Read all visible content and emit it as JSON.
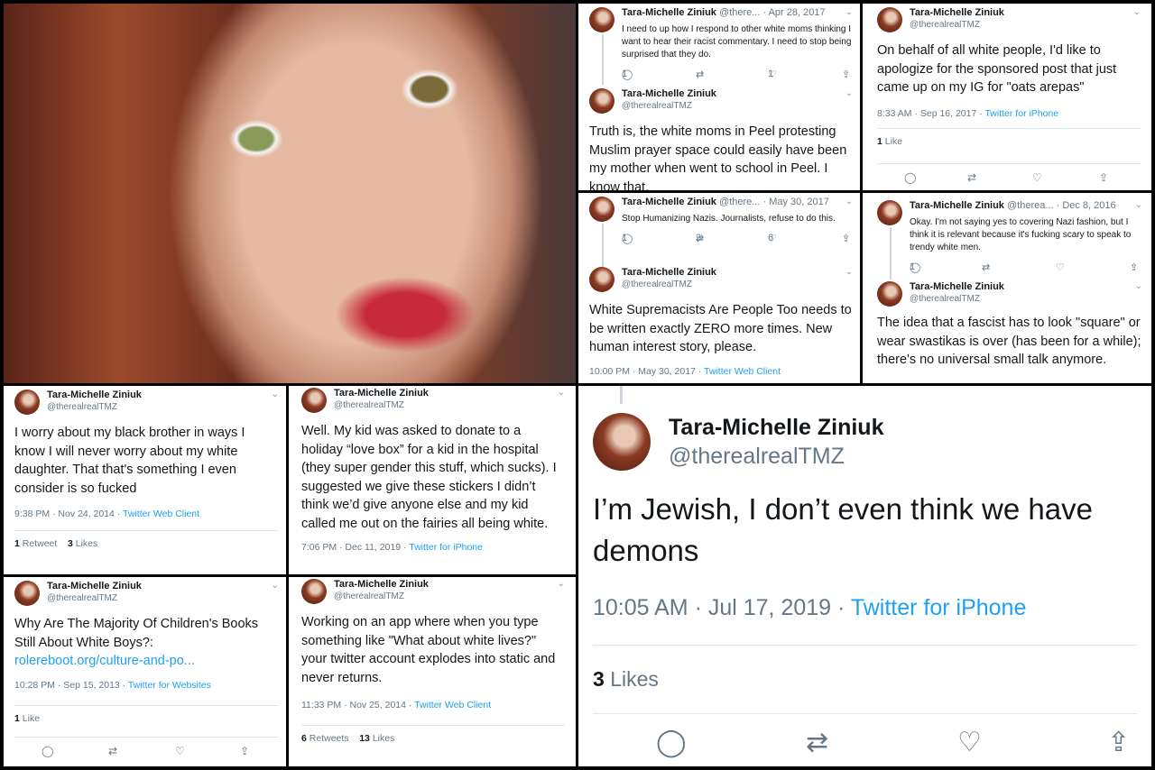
{
  "author": {
    "name": "Tara-Michelle Ziniuk",
    "handle": "@therealrealTMZ",
    "handle_trunc": "@there...",
    "handle_trunc2": "@therea..."
  },
  "colors": {
    "link": "#1da1f2",
    "meta": "#657786",
    "text": "#14171a",
    "border": "#e1e8ed"
  },
  "icons": [
    "reply-icon",
    "retweet-icon",
    "like-icon",
    "share-icon",
    "chevron-down-icon"
  ],
  "glyphs": {
    "reply": "◯",
    "retweet": "⇄",
    "like": "♡",
    "share": "⇪",
    "chevron": "⌄"
  },
  "p2": {
    "first_date": "· Apr 28, 2017",
    "first_text": "I need to up how I respond to other white moms thinking I want to hear their racist commentary. I need to stop being surprised that they do.",
    "first_replies": "1",
    "first_likes": "1",
    "second_text": "Truth is, the white moms in Peel protesting Muslim prayer space could easily have been my mother when went to school in Peel. I know that."
  },
  "p3": {
    "text": "On behalf of all white people, I'd like to apologize for the sponsored post that just came up on my IG for \"oats arepas\"",
    "time": "8:33 AM · Sep 16, 2017 · ",
    "source": "Twitter for iPhone",
    "likes_count": "1",
    "likes_label": "Like"
  },
  "p4": {
    "first_date": "· May 30, 2017",
    "first_text": "Stop Humanizing Nazis. Journalists, refuse to do this.",
    "first_replies": "1",
    "first_retweets": "3",
    "first_likes": "6",
    "second_text": "White Supremacists Are People Too needs to be written exactly ZERO more times. New human interest story, please.",
    "time": "10:00 PM · May 30, 2017 · ",
    "source": "Twitter Web Client"
  },
  "p5": {
    "first_date": "· Dec 8, 2016",
    "first_text": "Okay. I'm not saying yes to covering Nazi fashion, but I think it is relevant because it's fucking scary to speak to trendy white men.",
    "first_replies": "1",
    "second_text": "The idea that a fascist has to look \"square\" or wear swastikas is over (has been for a while); there's no universal small talk anymore."
  },
  "p6": {
    "text": "I worry about my black brother in ways I know I will never worry about my white daughter. That that's something I even consider is so fucked",
    "time": "9:38 PM · Nov 24, 2014 · ",
    "source": "Twitter Web Client",
    "retweets_count": "1",
    "retweets_label": "Retweet",
    "likes_count": "3",
    "likes_label": "Likes"
  },
  "p7": {
    "text": "Well. My kid was asked to donate to a holiday “love box” for a kid in the hospital (they super gender this stuff, which sucks). I suggested we give these stickers I didn’t think we’d give anyone else and my kid called me out on the fairies all being white.",
    "time": "7:06 PM · Dec 11, 2019 · ",
    "source": "Twitter for iPhone"
  },
  "p8": {
    "text": "Why Are The Majority Of Children's Books Still About White Boys?:",
    "link": "rolereboot.org/culture-and-po...",
    "time": "10:28 PM · Sep 15, 2013 · ",
    "source": "Twitter for Websites",
    "likes_count": "1",
    "likes_label": "Like"
  },
  "p9": {
    "text": "Working on an app where when you type something like \"What about white lives?\" your twitter account explodes into static and never returns.",
    "time": "11:33 PM · Nov 25, 2014 · ",
    "source": "Twitter Web Client",
    "retweets_count": "6",
    "retweets_label": "Retweets",
    "likes_count": "13",
    "likes_label": "Likes"
  },
  "p10": {
    "text": "I’m Jewish, I don’t even think we have demons",
    "time": "10:05 AM · Jul 17, 2019 · ",
    "source": "Twitter for iPhone",
    "likes_count": "3",
    "likes_label": "Likes"
  }
}
